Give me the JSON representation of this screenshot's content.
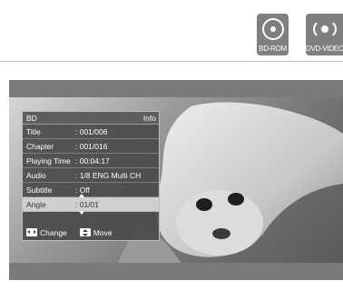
{
  "badges": [
    {
      "label": "BD-ROM",
      "icon": "disc-icon"
    },
    {
      "label": "DVD-VIDEO",
      "icon": "dvd-disc-icon"
    }
  ],
  "panel": {
    "title": "BD",
    "subtitle": "Info",
    "rows": [
      {
        "key": "Title",
        "value": ": 001/006"
      },
      {
        "key": "Chapter",
        "value": ": 001/016"
      },
      {
        "key": "Playing Time",
        "value": ": 00:04:17"
      },
      {
        "key": "Audio",
        "value": ": 1/8 ENG Multi CH"
      },
      {
        "key": "Subtitle",
        "value": ": Off"
      },
      {
        "key": "Angle",
        "value": ": 01/01",
        "selected": true
      }
    ],
    "footer": {
      "change_label": "Change",
      "move_label": "Move"
    }
  },
  "colors": {
    "badge": "#7f7f7f",
    "screen": "#7a7a7a",
    "panel": "#484848",
    "selected_row": "#cfcfcf"
  }
}
